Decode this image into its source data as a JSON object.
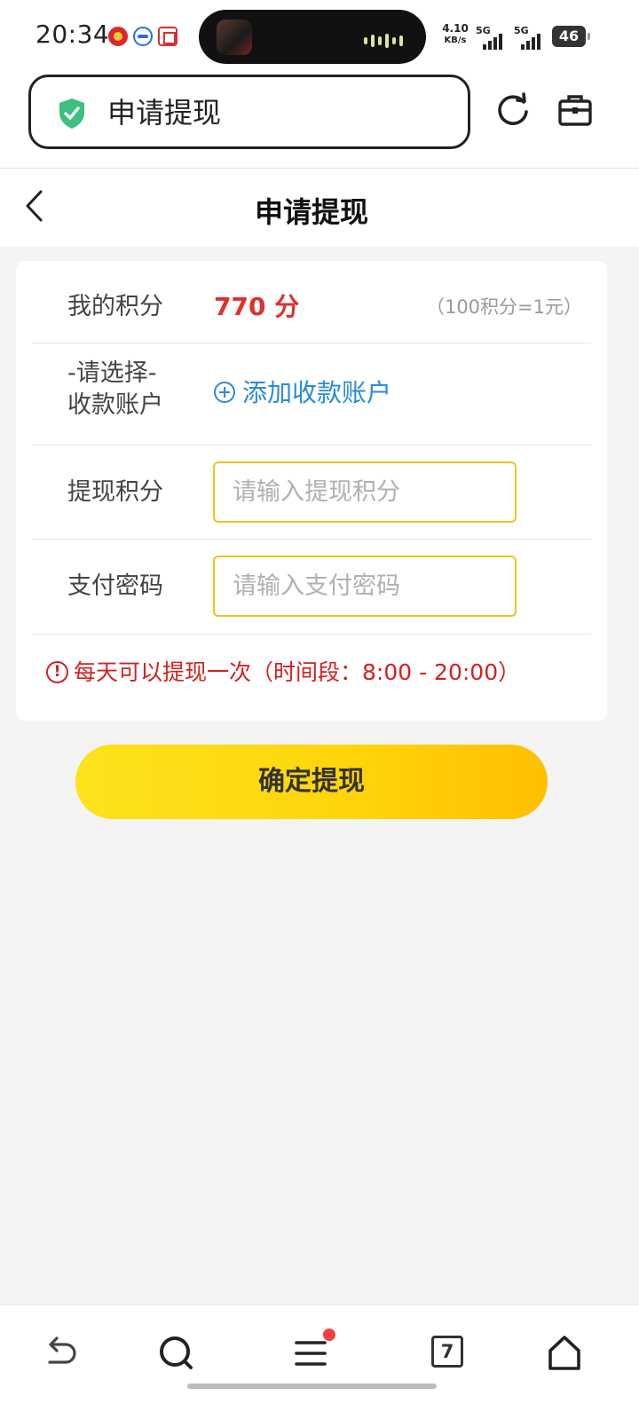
{
  "status_bar": {
    "time": "20:34",
    "net_speed_value": "4.10",
    "net_speed_unit": "KB/s",
    "sim1": "5G",
    "sim2": "5G",
    "battery": "46"
  },
  "browser": {
    "url_title": "申请提现",
    "icons": {
      "secure": "shield-check-icon",
      "reload": "reload-icon",
      "toolbox": "toolbox-icon"
    }
  },
  "header": {
    "title": "申请提现"
  },
  "form": {
    "points_label": "我的积分",
    "points_value": "770 分",
    "points_rate": "（100积分=1元）",
    "account_label": "-请选择-\n收款账户",
    "add_account_label": "添加收款账户",
    "amount_label": "提现积分",
    "amount_value": "",
    "amount_placeholder": "请输入提现积分",
    "password_label": "支付密码",
    "password_value": "",
    "password_placeholder": "请输入支付密码",
    "notice": "每天可以提现一次（时间段：8:00 - 20:00）",
    "submit_label": "确定提现"
  },
  "bottom_nav": {
    "tab_count": "7",
    "icons": [
      "back-icon",
      "search-icon",
      "menu-icon",
      "tabs-icon",
      "home-icon"
    ]
  },
  "colors": {
    "accent_yellow": "#ffd40a",
    "points_red": "#e03030",
    "link_blue": "#2b8ad8",
    "warning_red": "#d42020",
    "secure_green": "#3cbf7f"
  }
}
